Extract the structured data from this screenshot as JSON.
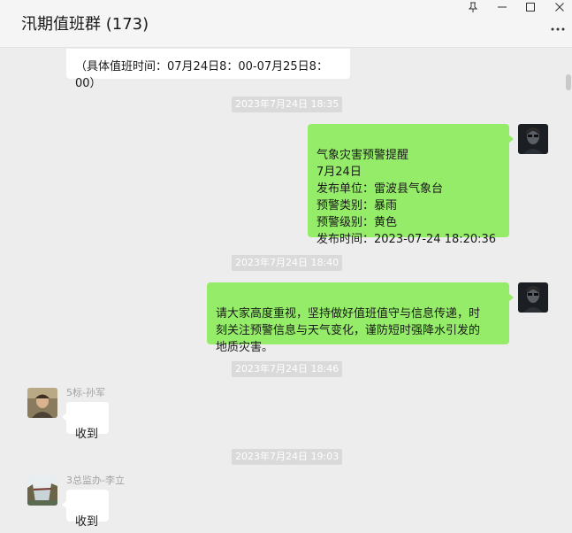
{
  "window": {
    "title": "汛期值班群 (173)",
    "pin_icon": "pin-icon",
    "min_icon": "minimize-icon",
    "max_icon": "maximize-icon",
    "close_icon": "close-icon",
    "more_icon": "more-icon"
  },
  "messages": {
    "m0": {
      "text": "（具体值班时间：07月24日8：00-07月25日8：\n00）"
    },
    "t1": "2023年7月24日 18:35",
    "m1": {
      "text": "气象灾害预警提醒\n7月24日\n发布单位：雷波县气象台\n预警类别：暴雨\n预警级别：黄色\n发布时间：2023-07-24 18:20:36"
    },
    "t2": "2023年7月24日 18:40",
    "m2": {
      "text": "请大家高度重视，坚持做好值班值守与信息传递，时\n刻关注预警信息与天气变化，谨防短时强降水引发的\n地质灾害。"
    },
    "t3": "2023年7月24日 18:46",
    "m3": {
      "sender": "5标-孙军",
      "text": "收到"
    },
    "t4": "2023年7月24日 19:03",
    "m4": {
      "sender": "3总监办-李立",
      "text": "收到"
    }
  },
  "colors": {
    "self_bubble": "#95ec69",
    "other_bubble": "#ffffff",
    "chat_background": "#ededed"
  }
}
